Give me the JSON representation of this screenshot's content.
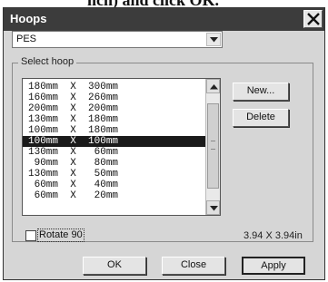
{
  "dialog": {
    "title": "Hoops",
    "close_glyph": "X"
  },
  "format_select": {
    "value": "PES"
  },
  "hoop_group": {
    "label": "Select hoop",
    "items": [
      "180mm  X  300mm",
      "160mm  X  260mm",
      "200mm  X  200mm",
      "130mm  X  180mm",
      "100mm  X  180mm",
      "100mm  X  100mm",
      "130mm  X   60mm",
      " 90mm  X   80mm",
      "130mm  X   50mm",
      " 60mm  X   40mm",
      " 60mm  X   20mm"
    ],
    "selected_index": 5,
    "new_label": "New...",
    "delete_label": "Delete"
  },
  "rotate": {
    "label": "Rotate 90",
    "checked": false
  },
  "dimensions_text": "3.94 X 3.94in",
  "buttons": {
    "ok": "OK",
    "close": "Close",
    "apply": "Apply"
  }
}
